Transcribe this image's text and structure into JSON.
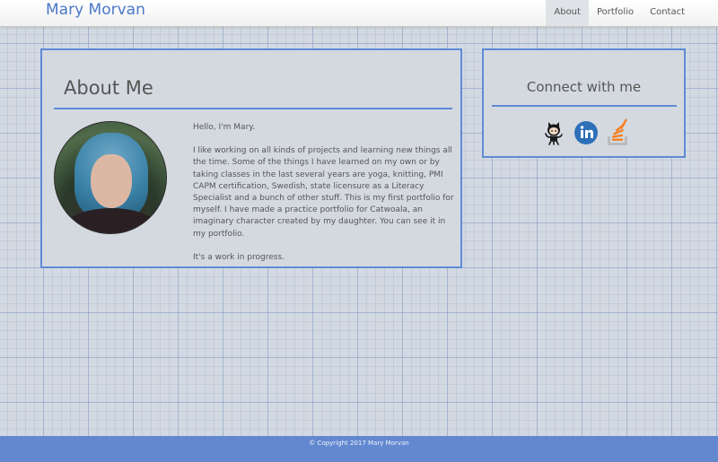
{
  "navbar": {
    "brand": "Mary Morvan",
    "items": [
      {
        "label": "About",
        "active": true
      },
      {
        "label": "Portfolio",
        "active": false
      },
      {
        "label": "Contact",
        "active": false
      }
    ]
  },
  "about": {
    "title": "About Me",
    "greeting": "Hello, I'm Mary.",
    "paragraph": "I like working on all kinds of projects and learning new things all the time. Some of the things I have learned on my own or by taking classes in the last several years are yoga, knitting, PMI CAPM certification, Swedish, state licensure as a Literacy Specialist and a bunch of other stuff. This is my first portfolio for myself. I have made a practice portfolio for Catwoala, an imaginary character created by my daughter. You can see it in my portfolio.",
    "closing": "It's a work in progress."
  },
  "connect": {
    "title": "Connect with me",
    "icons": [
      "github-icon",
      "linkedin-icon",
      "stackoverflow-icon"
    ]
  },
  "footer": {
    "text": "© Copyright 2017 Mary Morvan"
  },
  "colors": {
    "accent": "#5f8bd6",
    "brand": "#4a78c8",
    "footer": "#6288d0",
    "linkedin": "#2e70b8",
    "stackoverflow": "#f48024"
  }
}
